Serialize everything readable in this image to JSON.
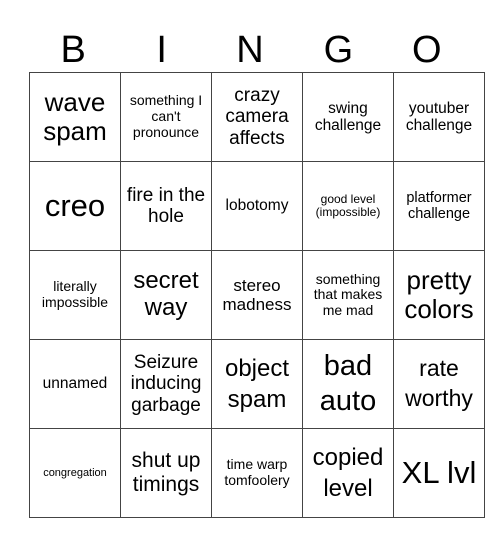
{
  "title_letters": [
    "B",
    "I",
    "N",
    "G",
    "O"
  ],
  "cells": [
    [
      "wave spam",
      "something I can't pronounce",
      "crazy camera affects",
      "swing challenge",
      "youtuber challenge"
    ],
    [
      "creo",
      "fire in the hole",
      "lobotomy",
      "good level (impossible)",
      "platformer challenge"
    ],
    [
      "literally impossible",
      "secret way",
      "stereo madness",
      "something that makes me mad",
      "pretty colors"
    ],
    [
      "unnamed",
      "Seizure inducing garbage",
      "object spam",
      "bad auto",
      "rate worthy"
    ],
    [
      "congregation",
      "shut up timings",
      "time warp tomfoolery",
      "copied level",
      "XL lvl"
    ]
  ]
}
